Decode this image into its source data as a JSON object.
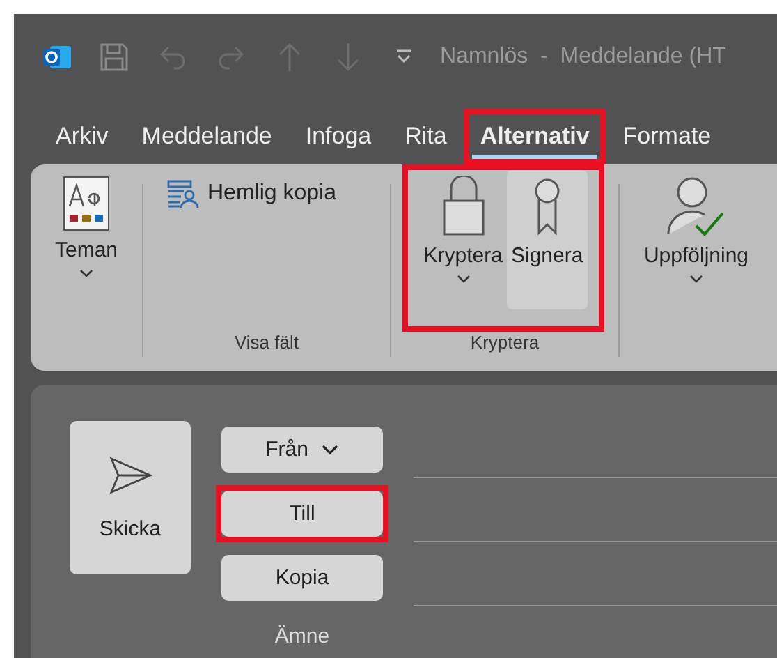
{
  "title_bar": {
    "title": "Namnlös  -  Meddelande (HT"
  },
  "tabs": [
    {
      "label": "Arkiv",
      "selected": false,
      "highlighted": false
    },
    {
      "label": "Meddelande",
      "selected": false,
      "highlighted": false
    },
    {
      "label": "Infoga",
      "selected": false,
      "highlighted": false
    },
    {
      "label": "Rita",
      "selected": false,
      "highlighted": false
    },
    {
      "label": "Alternativ",
      "selected": true,
      "highlighted": true
    },
    {
      "label": "Formate",
      "selected": false,
      "highlighted": false
    }
  ],
  "ribbon": {
    "groups": [
      {
        "highlighted": false,
        "buttons": [
          {
            "kind": "theme",
            "label": "Teman",
            "dropdown": true,
            "pressed": false
          }
        ]
      },
      {
        "label": "Visa fält",
        "highlighted": false,
        "buttons": [
          {
            "kind": "bcc",
            "label": "Hemlig kopia",
            "dropdown": false,
            "pressed": false
          }
        ]
      },
      {
        "label": "Kryptera",
        "highlighted": true,
        "buttons": [
          {
            "kind": "lock",
            "label": "Kryptera",
            "dropdown": true,
            "pressed": false
          },
          {
            "kind": "seal",
            "label": "Signera",
            "dropdown": false,
            "pressed": true
          }
        ]
      },
      {
        "highlighted": false,
        "buttons": [
          {
            "kind": "followup",
            "label": "Uppföljning",
            "dropdown": true,
            "pressed": false
          }
        ]
      }
    ]
  },
  "compose": {
    "send": "Skicka",
    "fields": [
      {
        "kind": "dropdown",
        "label": "Från",
        "highlighted": false
      },
      {
        "kind": "button",
        "label": "Till",
        "highlighted": true
      },
      {
        "kind": "button",
        "label": "Kopia",
        "highlighted": false
      },
      {
        "kind": "label",
        "label": "Ämne",
        "highlighted": false
      }
    ]
  }
}
